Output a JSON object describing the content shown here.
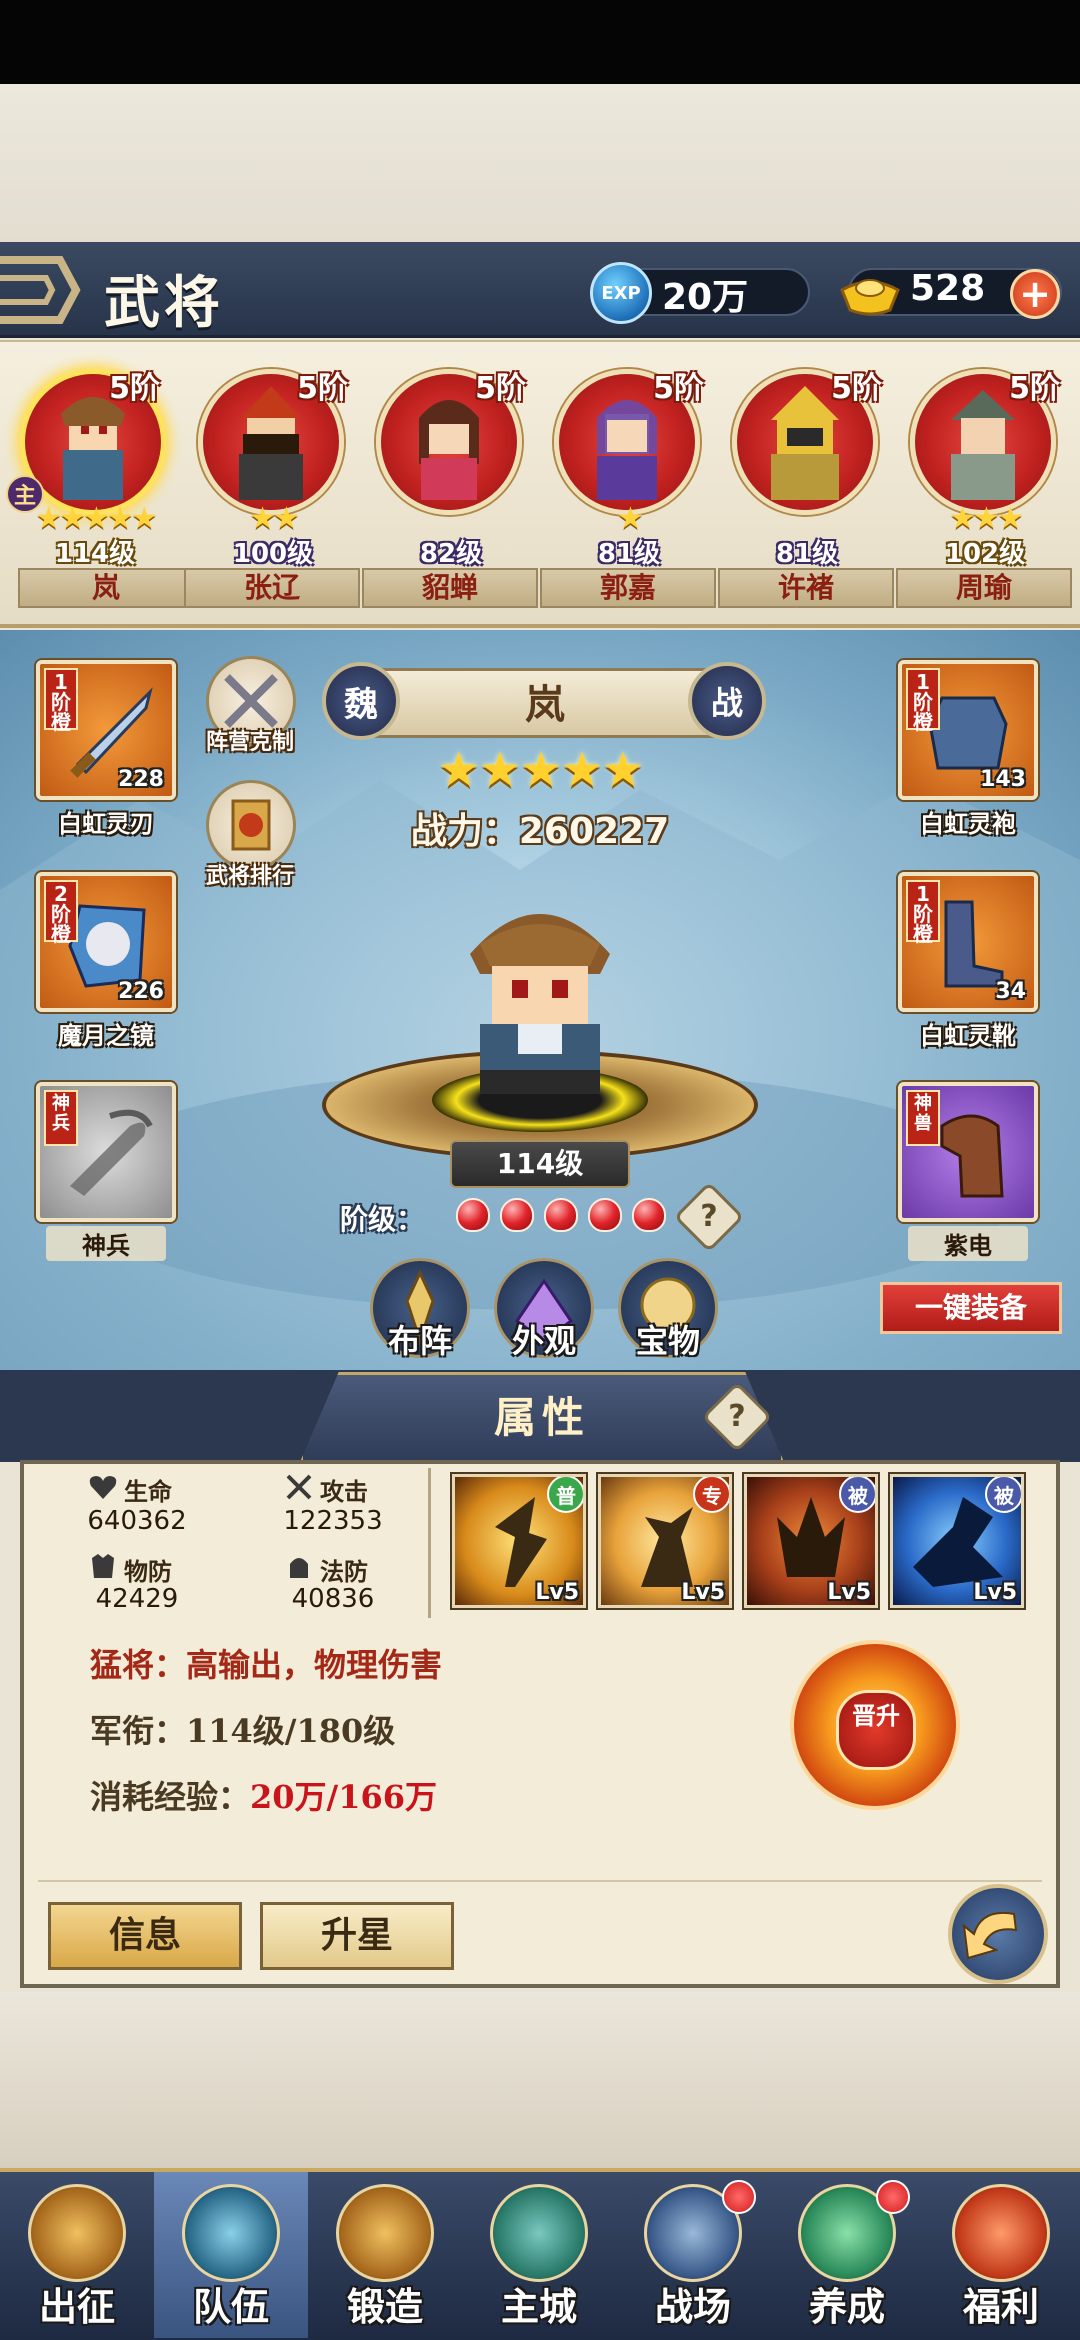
{
  "header": {
    "title": "武将",
    "exp_value": "20万",
    "exp_icon_text": "EXP",
    "gold_value": "528",
    "plus": "+"
  },
  "heroes": [
    {
      "name": "岚",
      "level": "114级",
      "rank": "5阶",
      "stars": "★★★★★",
      "selected": true,
      "main_tag": "主"
    },
    {
      "name": "张辽",
      "level": "100级",
      "rank": "5阶",
      "stars": "★★"
    },
    {
      "name": "貂蝉",
      "level": "82级",
      "rank": "5阶",
      "stars": ""
    },
    {
      "name": "郭嘉",
      "level": "81级",
      "rank": "5阶",
      "stars": "★"
    },
    {
      "name": "许褚",
      "level": "81级",
      "rank": "5阶",
      "stars": ""
    },
    {
      "name": "周瑜",
      "level": "102级",
      "rank": "5阶",
      "stars": "★★★"
    }
  ],
  "equipment": {
    "left": [
      {
        "label": "白虹灵刃",
        "tier": "1阶",
        "tier_suffix": "橙",
        "count": "228"
      },
      {
        "label": "魔月之镜",
        "tier": "2阶",
        "tier_suffix": "橙",
        "count": "226"
      },
      {
        "label": "神兵",
        "tier": "神兵",
        "count": ""
      }
    ],
    "right": [
      {
        "label": "白虹灵袍",
        "tier": "1阶",
        "tier_suffix": "橙",
        "count": "143"
      },
      {
        "label": "白虹灵靴",
        "tier": "1阶",
        "tier_suffix": "橙",
        "count": "34"
      },
      {
        "label": "紫电",
        "tier": "神兽",
        "count": ""
      }
    ]
  },
  "side_buttons": {
    "counter": "阵营克制",
    "ranking": "武将排行"
  },
  "selected_hero": {
    "name": "岚",
    "faction": "魏",
    "role": "战",
    "stars": "★★★★★",
    "power": "战力：260227",
    "level": "114级",
    "stage_label": "阶级：",
    "gem_count": 5
  },
  "help_symbol": "?",
  "equip_all": "一键装备",
  "actions": [
    "布阵",
    "外观",
    "宝物"
  ],
  "panel": {
    "title": "属性",
    "stats": {
      "hp_label": "生命",
      "hp_value": "640362",
      "atk_label": "攻击",
      "atk_value": "122353",
      "pdef_label": "物防",
      "pdef_value": "42429",
      "mdef_label": "法防",
      "mdef_value": "40836"
    },
    "skills": [
      {
        "level": "Lv5",
        "tag": "普",
        "tag_color": "#3aa84a"
      },
      {
        "level": "Lv5",
        "tag": "专",
        "tag_color": "#c8341a"
      },
      {
        "level": "Lv5",
        "tag": "被",
        "tag_color": "#4a5aa8"
      },
      {
        "level": "Lv5",
        "tag": "被",
        "tag_color": "#4a5aa8"
      }
    ],
    "desc": "猛将：高输出，物理伤害",
    "rank_line": "军衔：114级/180级",
    "exp_label": "消耗经验：",
    "exp_value": "20万/166万",
    "promote": "晋升",
    "info_button": "信息",
    "star_button": "升星"
  },
  "nav": [
    {
      "label": "出征",
      "dot": false
    },
    {
      "label": "队伍",
      "dot": false,
      "active": true
    },
    {
      "label": "锻造",
      "dot": false
    },
    {
      "label": "主城",
      "dot": false
    },
    {
      "label": "战场",
      "dot": true
    },
    {
      "label": "养成",
      "dot": true
    },
    {
      "label": "福利",
      "dot": false
    }
  ],
  "colors": {
    "accent_red": "#c22220",
    "header_bg": "#2f3c56",
    "gold": "#ffd12e"
  }
}
